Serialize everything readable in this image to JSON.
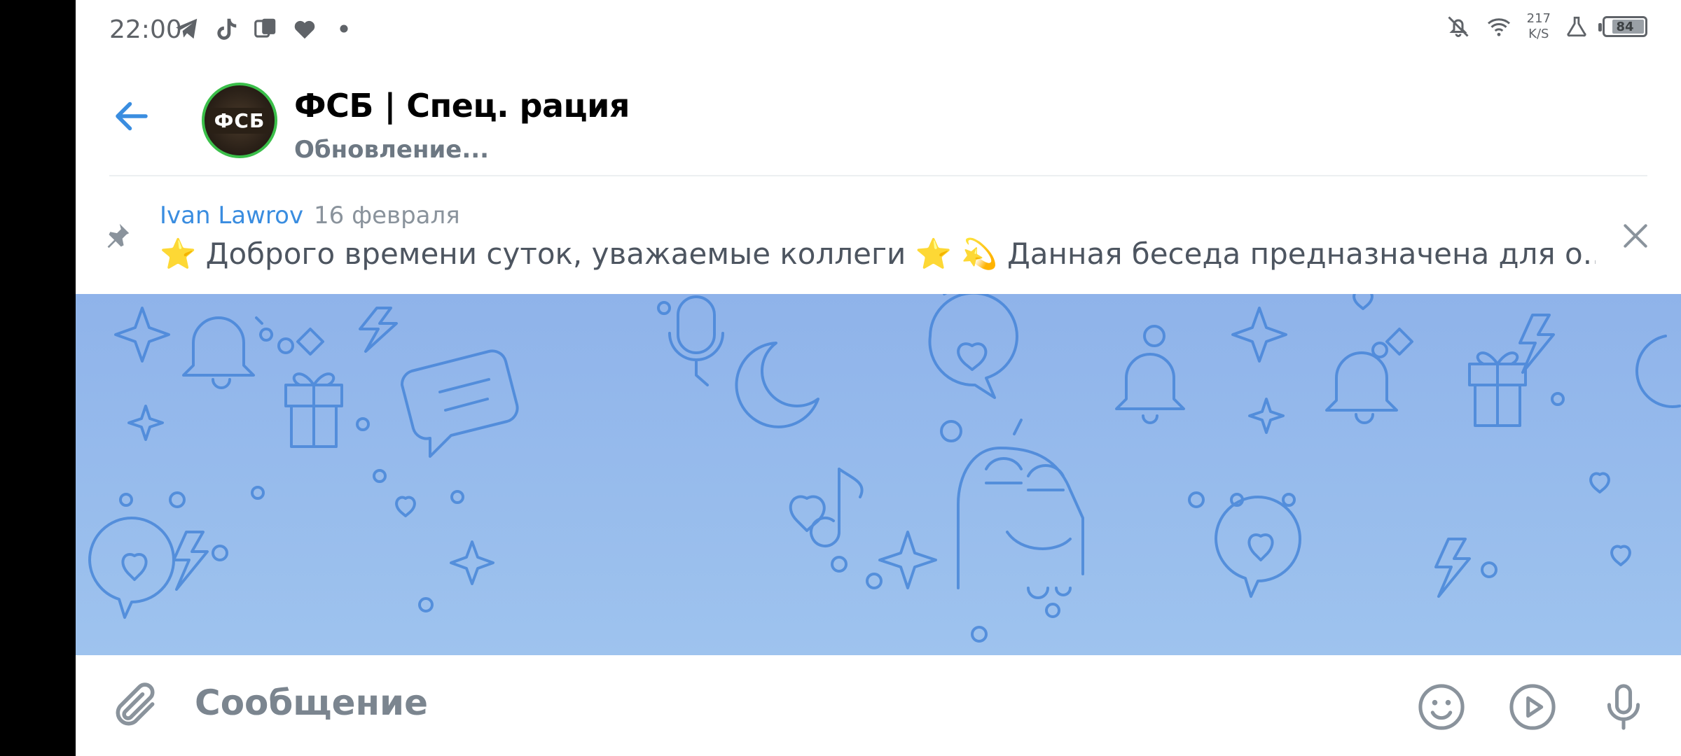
{
  "status_bar": {
    "time": "22:00",
    "network_speed_value": "217",
    "network_speed_unit": "K/S",
    "battery": "84",
    "battery_level_percent": 84,
    "left_icons": [
      "telegram-icon",
      "tiktok-icon",
      "app-icon",
      "heart-icon",
      "dot-icon"
    ],
    "right_icons": [
      "notifications-off-icon",
      "wifi-icon",
      "lab-icon",
      "battery-icon"
    ]
  },
  "header": {
    "title": "ФСБ | Спец. рация",
    "subtitle": "Обновление...",
    "avatar_text": "ФСБ",
    "accent_color": "#3a8de0"
  },
  "pinned": {
    "author": "Ivan Lawrov",
    "date": "16 февраля",
    "text": "⭐ Доброго времени суток, уважаемые коллеги ⭐  💫 Данная беседа предназначена для о..."
  },
  "input": {
    "placeholder": "Сообщение"
  },
  "colors": {
    "accent": "#3a8de0",
    "chat_background": "#9ec3ee",
    "avatar_border": "#3bbf4a"
  }
}
